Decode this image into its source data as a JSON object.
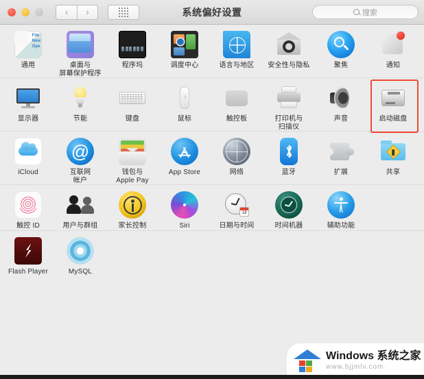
{
  "window": {
    "title": "系统偏好设置",
    "traffic_lights": [
      "close",
      "minimize",
      "zoom"
    ],
    "nav": {
      "back": "‹",
      "forward": "›"
    },
    "grid_button": "grid-view",
    "search": {
      "placeholder": "搜索",
      "value": ""
    }
  },
  "rows": [
    {
      "id": "row-1",
      "items": [
        {
          "name": "general",
          "label": "通用",
          "icon": "general-icon"
        },
        {
          "name": "desktop",
          "label": "桌面与\n屏幕保护程序",
          "icon": "desktop-screensaver-icon"
        },
        {
          "name": "dock",
          "label": "程序坞",
          "icon": "dock-icon"
        },
        {
          "name": "mission",
          "label": "调度中心",
          "icon": "mission-control-icon"
        },
        {
          "name": "language",
          "label": "语言与地区",
          "icon": "language-region-icon"
        },
        {
          "name": "security",
          "label": "安全性与隐私",
          "icon": "security-privacy-icon"
        },
        {
          "name": "spotlight",
          "label": "聚焦",
          "icon": "spotlight-icon"
        },
        {
          "name": "notifications",
          "label": "通知",
          "icon": "notifications-icon"
        }
      ]
    },
    {
      "id": "row-2",
      "items": [
        {
          "name": "displays",
          "label": "显示器",
          "icon": "displays-icon"
        },
        {
          "name": "energy",
          "label": "节能",
          "icon": "energy-saver-icon"
        },
        {
          "name": "keyboard",
          "label": "键盘",
          "icon": "keyboard-icon"
        },
        {
          "name": "mouse",
          "label": "鼠标",
          "icon": "mouse-icon"
        },
        {
          "name": "trackpad",
          "label": "触控板",
          "icon": "trackpad-icon"
        },
        {
          "name": "printers",
          "label": "打印机与\n扫描仪",
          "icon": "printers-scanners-icon"
        },
        {
          "name": "sound",
          "label": "声音",
          "icon": "sound-icon"
        },
        {
          "name": "startupdisk",
          "label": "启动磁盘",
          "icon": "startup-disk-icon",
          "highlighted": true
        }
      ]
    },
    {
      "id": "row-3",
      "items": [
        {
          "name": "icloud",
          "label": "iCloud",
          "icon": "icloud-icon"
        },
        {
          "name": "internet",
          "label": "互联网\n帐户",
          "icon": "internet-accounts-icon"
        },
        {
          "name": "wallet",
          "label": "钱包与\nApple Pay",
          "icon": "wallet-applepay-icon"
        },
        {
          "name": "appstore",
          "label": "App Store",
          "icon": "app-store-icon"
        },
        {
          "name": "network",
          "label": "网络",
          "icon": "network-icon"
        },
        {
          "name": "bluetooth",
          "label": "蓝牙",
          "icon": "bluetooth-icon"
        },
        {
          "name": "extensions",
          "label": "扩展",
          "icon": "extensions-icon"
        },
        {
          "name": "sharing",
          "label": "共享",
          "icon": "sharing-icon"
        }
      ]
    },
    {
      "id": "row-4",
      "items": [
        {
          "name": "touchid",
          "label": "触控 ID",
          "icon": "touch-id-icon"
        },
        {
          "name": "users",
          "label": "用户与群组",
          "icon": "users-groups-icon"
        },
        {
          "name": "parental",
          "label": "家长控制",
          "icon": "parental-controls-icon"
        },
        {
          "name": "siri",
          "label": "Siri",
          "icon": "siri-icon"
        },
        {
          "name": "datetime",
          "label": "日期与时间",
          "icon": "date-time-icon"
        },
        {
          "name": "timemachine",
          "label": "时间机器",
          "icon": "time-machine-icon"
        },
        {
          "name": "accessibility",
          "label": "辅助功能",
          "icon": "accessibility-icon"
        }
      ]
    },
    {
      "id": "row-5",
      "items": [
        {
          "name": "flashplayer",
          "label": "Flash Player",
          "icon": "flash-player-icon"
        },
        {
          "name": "mysql",
          "label": "MySQL",
          "icon": "mysql-icon"
        }
      ]
    }
  ],
  "highlight": {
    "color": "#f04a36",
    "target": "启动磁盘"
  },
  "watermark": {
    "brand_en": "Windows ",
    "brand_cn": "系统之家",
    "url": "www.bjjmlv.com"
  }
}
